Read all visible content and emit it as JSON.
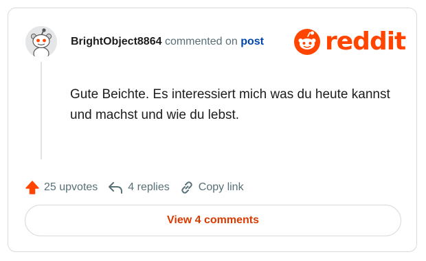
{
  "comment": {
    "username": "BrightObject8864",
    "commented_on": "commented on",
    "post_link": "post",
    "body": "Gute Beichte. Es interessiert mich was du heute kannst und machst und wie du lebst."
  },
  "brand": {
    "name": "reddit",
    "color": "#ff4500"
  },
  "actions": {
    "upvotes": "25 upvotes",
    "replies": "4 replies",
    "copy_link": "Copy link"
  },
  "view_comments": "View 4 comments",
  "icons": {
    "avatar": "snoo-avatar-icon",
    "logo": "reddit-snoo-icon",
    "upvote": "upvote-arrow-icon",
    "reply": "reply-arrow-icon",
    "link": "chain-link-icon"
  }
}
